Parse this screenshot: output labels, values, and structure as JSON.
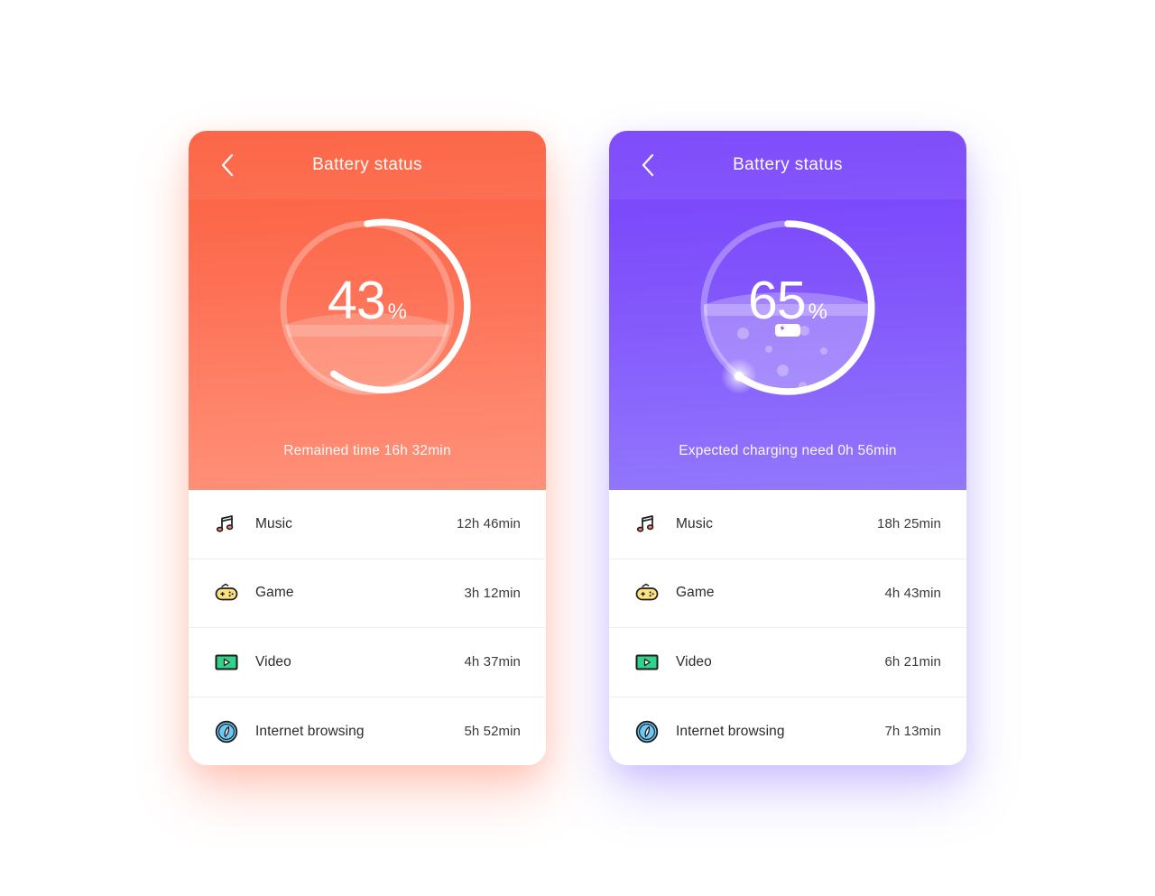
{
  "cards": [
    {
      "id": "battery-discharging",
      "theme": "red",
      "accent": "#FB5F3E",
      "accent_end": "#FF9079",
      "title": "Battery status",
      "back_icon": "chevron-left-icon",
      "percent_value": "43",
      "percent_sign": "%",
      "percent_number": 43,
      "status_text": "Remained time 16h 32min",
      "charging": false,
      "rows": [
        {
          "icon": "music-note-icon",
          "label": "Music",
          "value": "12h 46min"
        },
        {
          "icon": "gamepad-icon",
          "label": "Game",
          "value": "3h 12min"
        },
        {
          "icon": "video-play-icon",
          "label": "Video",
          "value": "4h 37min"
        },
        {
          "icon": "compass-icon",
          "label": "Internet browsing",
          "value": "5h 52min"
        }
      ]
    },
    {
      "id": "battery-charging",
      "theme": "purple",
      "accent": "#7540FA",
      "accent_end": "#9278FC",
      "title": "Battery status",
      "back_icon": "chevron-left-icon",
      "percent_value": "65",
      "percent_sign": "%",
      "percent_number": 65,
      "status_text": "Expected charging need 0h 56min",
      "charging": true,
      "charge_icon": "battery-charging-icon",
      "rows": [
        {
          "icon": "music-note-icon",
          "label": "Music",
          "value": "18h 25min"
        },
        {
          "icon": "gamepad-icon",
          "label": "Game",
          "value": "4h 43min"
        },
        {
          "icon": "video-play-icon",
          "label": "Video",
          "value": "6h 21min"
        },
        {
          "icon": "compass-icon",
          "label": "Internet browsing",
          "value": "7h 13min"
        }
      ]
    }
  ],
  "icon_colors": {
    "music_note": "#FF7E6B",
    "gamepad": "#FBE27E",
    "video": "#2FD48A",
    "compass": "#6EC7F5",
    "outline": "#1d1d1d"
  }
}
